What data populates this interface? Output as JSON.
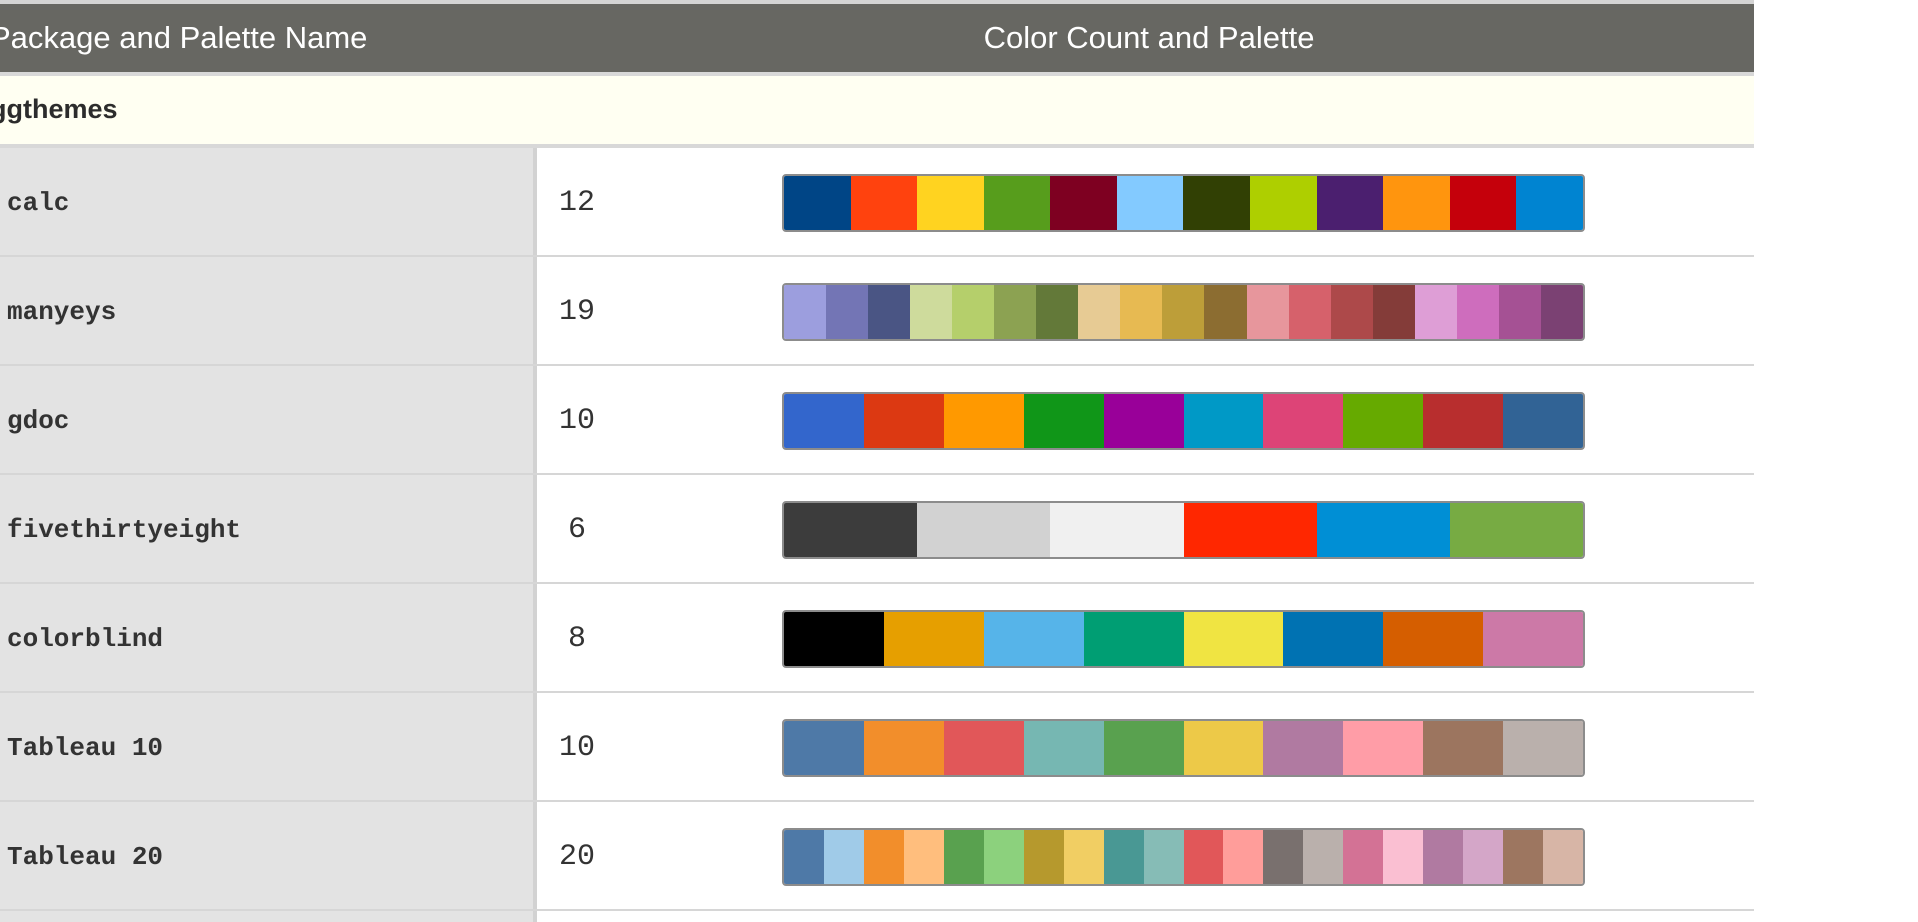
{
  "header": {
    "col1": "Package and Palette Name",
    "col2": "Color Count and Palette"
  },
  "group": {
    "label": "ggthemes"
  },
  "palettes": [
    {
      "name": "calc",
      "count": "12",
      "colors": [
        "#004586",
        "#FF420E",
        "#FFD320",
        "#579D1C",
        "#7E0021",
        "#83CAFF",
        "#314004",
        "#AECF00",
        "#4B1F6F",
        "#FF950E",
        "#C5000B",
        "#0084D1"
      ]
    },
    {
      "name": "manyeys",
      "count": "19",
      "colors": [
        "#9C9EDE",
        "#7375B5",
        "#4A5584",
        "#CEDB9C",
        "#B5CF6B",
        "#8CA252",
        "#637939",
        "#E7CB94",
        "#E7BA52",
        "#BD9E39",
        "#8C6D31",
        "#E7969C",
        "#D6616B",
        "#AD494A",
        "#843C39",
        "#DE9ED6",
        "#CE6DBD",
        "#A55194",
        "#7B4173"
      ]
    },
    {
      "name": "gdoc",
      "count": "10",
      "colors": [
        "#3366CC",
        "#DC3912",
        "#FF9900",
        "#109618",
        "#990099",
        "#0099C6",
        "#DD4477",
        "#66AA00",
        "#B82E2E",
        "#316395"
      ]
    },
    {
      "name": "fivethirtyeight",
      "count": "6",
      "colors": [
        "#3C3C3C",
        "#D2D2D2",
        "#F0F0F0",
        "#FF2700",
        "#008FD5",
        "#77AB43"
      ]
    },
    {
      "name": "colorblind",
      "count": "8",
      "colors": [
        "#000000",
        "#E69F00",
        "#56B4E9",
        "#009E73",
        "#F0E442",
        "#0072B2",
        "#D55E00",
        "#CC79A7"
      ]
    },
    {
      "name": "Tableau 10",
      "count": "10",
      "colors": [
        "#4E79A7",
        "#F28E2B",
        "#E15759",
        "#76B7B2",
        "#59A14F",
        "#EDC948",
        "#B07AA1",
        "#FF9DA7",
        "#9C755F",
        "#BAB0AC"
      ]
    },
    {
      "name": "Tableau 20",
      "count": "20",
      "colors": [
        "#4E79A7",
        "#A0CBE8",
        "#F28E2B",
        "#FFBE7D",
        "#59A14F",
        "#8CD17D",
        "#B6992D",
        "#F1CE63",
        "#499894",
        "#86BCB6",
        "#E15759",
        "#FF9D9A",
        "#79706E",
        "#BAB0AC",
        "#D37295",
        "#FABFD2",
        "#B07AA1",
        "#D4A6C8",
        "#9D7660",
        "#D7B5A6"
      ]
    }
  ]
}
